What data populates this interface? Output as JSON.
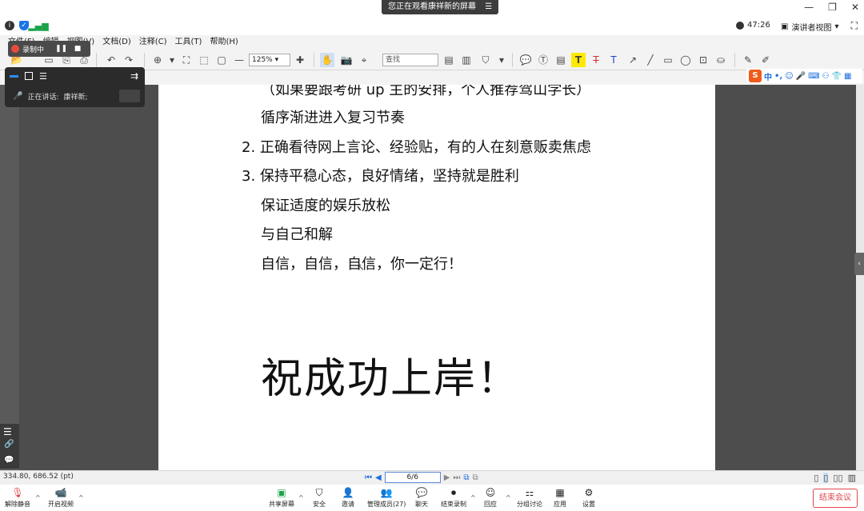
{
  "meeting": {
    "banner": "您正在观看康祥新的屏幕",
    "timer": "47:26",
    "speaker_view": "演讲者视图",
    "recording_label": "录制中",
    "talking_label": "正在讲话:",
    "talking_name": "康祥新;"
  },
  "pdf_menu": [
    "文件(F)",
    "编辑",
    "视图(V)",
    "文档(D)",
    "注释(C)",
    "工具(T)",
    "帮助(H)"
  ],
  "toolbar": {
    "zoom": "125%",
    "find_placeholder": "查找"
  },
  "page": {
    "lines": [
      {
        "text": "（如果要跟考研 up 主的安排，个人推荐驾山学长）"
      },
      {
        "text": "循序渐进进入复习节奏"
      },
      {
        "text": "2.  正确看待网上言论、经验贴，有的人在刻意贩卖焦虑"
      },
      {
        "text": "3.  保持平稳心态，良好情绪，坚持就是胜利"
      },
      {
        "text": "保证适度的娱乐放松"
      },
      {
        "text": "与自己和解"
      },
      {
        "text": "自信，自信，自信，你一定行！"
      }
    ],
    "slogan": "祝成功上岸！"
  },
  "status": {
    "coords": "334.80, 686.52 (pt)",
    "page_input": "6/6"
  },
  "bottom_bar": [
    {
      "label": "解除静音",
      "icon": "mic-off-icon"
    },
    {
      "label": "开启视频",
      "icon": "camera-off-icon"
    },
    {
      "label": "共享屏幕",
      "icon": "share-screen-icon"
    },
    {
      "label": "安全",
      "icon": "shield-icon"
    },
    {
      "label": "邀请",
      "icon": "invite-icon"
    },
    {
      "label": "管理成员(27)",
      "icon": "members-icon"
    },
    {
      "label": "聊天",
      "icon": "chat-icon"
    },
    {
      "label": "结束录制",
      "icon": "stop-record-icon"
    },
    {
      "label": "回应",
      "icon": "reaction-icon"
    },
    {
      "label": "分组讨论",
      "icon": "breakout-icon"
    },
    {
      "label": "应用",
      "icon": "apps-icon"
    },
    {
      "label": "设置",
      "icon": "gear-icon"
    }
  ],
  "end_meeting": "结束会议",
  "colors": {
    "accent": "#2d8cff",
    "danger": "#e0474c",
    "share_green": "#1aa34a"
  }
}
